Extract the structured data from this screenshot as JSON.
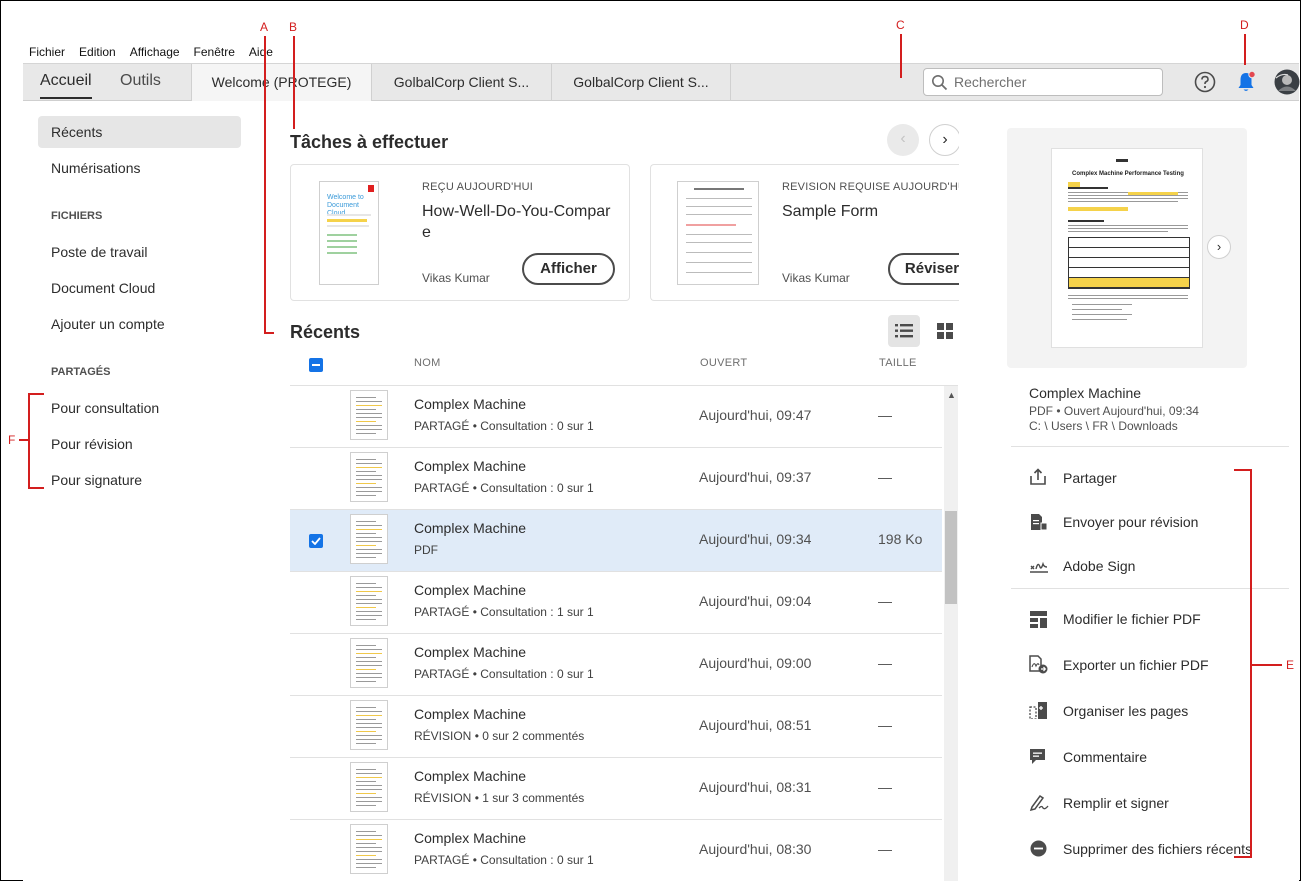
{
  "menu": {
    "items": [
      "Fichier",
      "Edition",
      "Affichage",
      "Fenêtre",
      "Aide"
    ]
  },
  "tabbar": {
    "home_tab": "Accueil",
    "tools_tab": "Outils",
    "doc_tabs": [
      "Welcome (PROTEGE)",
      "GolbalCorp Client S...",
      "GolbalCorp Client S..."
    ],
    "search_placeholder": "Rechercher"
  },
  "sidebar": {
    "recent": "Récents",
    "scans": "Numérisations",
    "files_heading": "FICHIERS",
    "files": [
      "Poste de travail",
      "Document Cloud",
      "Ajouter un compte"
    ],
    "shared_heading": "PARTAGÉS",
    "shared": [
      "Pour consultation",
      "Pour révision",
      "Pour signature"
    ]
  },
  "tasks": {
    "heading": "Tâches à effectuer",
    "cards": [
      {
        "tag": "REÇU AUJOURD'HUI",
        "title": "How-Well-Do-You-Compare",
        "owner": "Vikas Kumar",
        "button": "Afficher",
        "thumb_text": "Welcome to Document Cloud"
      },
      {
        "tag": "REVISION REQUISE AUJOURD'HUI",
        "title": "Sample Form",
        "owner": "Vikas Kumar",
        "button": "Réviser"
      }
    ]
  },
  "recent": {
    "heading": "Récents",
    "columns": {
      "name": "NOM",
      "opened": "OUVERT",
      "size": "TAILLE"
    },
    "rows": [
      {
        "name": "Complex Machine",
        "tag": "PARTAGÉ",
        "detail": "Consultation : 0 sur 1",
        "opened": "Aujourd'hui, 09:47",
        "size": "—",
        "selected": false
      },
      {
        "name": "Complex Machine",
        "tag": "PARTAGÉ",
        "detail": "Consultation : 0 sur 1",
        "opened": "Aujourd'hui, 09:37",
        "size": "—",
        "selected": false
      },
      {
        "name": "Complex Machine",
        "tag": "PDF",
        "detail": "",
        "opened": "Aujourd'hui, 09:34",
        "size": "198 Ko",
        "selected": true
      },
      {
        "name": "Complex Machine",
        "tag": "PARTAGÉ",
        "detail": "Consultation : 1 sur 1",
        "opened": "Aujourd'hui, 09:04",
        "size": "—",
        "selected": false
      },
      {
        "name": "Complex Machine",
        "tag": "PARTAGÉ",
        "detail": "Consultation : 0 sur 1",
        "opened": "Aujourd'hui, 09:00",
        "size": "—",
        "selected": false
      },
      {
        "name": "Complex Machine",
        "tag": "RÉVISION",
        "detail": "0 sur 2 commentés",
        "opened": "Aujourd'hui, 08:51",
        "size": "—",
        "selected": false
      },
      {
        "name": "Complex Machine",
        "tag": "RÉVISION",
        "detail": "1 sur 3 commentés",
        "opened": "Aujourd'hui, 08:31",
        "size": "—",
        "selected": false
      },
      {
        "name": "Complex Machine",
        "tag": "PARTAGÉ",
        "detail": "Consultation : 0 sur 1",
        "opened": "Aujourd'hui, 08:30",
        "size": "—",
        "selected": false
      }
    ]
  },
  "details": {
    "name": "Complex Machine",
    "type": "PDF",
    "opened": "Ouvert Aujourd'hui, 09:34",
    "path": "C: \\ Users \\ FR \\ Downloads",
    "preview_title": "Complex Machine Performance Testing",
    "actions_top": [
      "Partager",
      "Envoyer pour révision",
      "Adobe Sign"
    ],
    "actions_bottom": [
      "Modifier le fichier PDF",
      "Exporter un fichier PDF",
      "Organiser les pages",
      "Commentaire",
      "Remplir et signer",
      "Supprimer des fichiers récents"
    ]
  },
  "annotations": [
    "A",
    "B",
    "C",
    "D",
    "E",
    "F"
  ],
  "colors": {
    "accent": "#1473e6",
    "annotation": "#d31e1e",
    "selected_row": "#e0ebf8",
    "notification_dot": "#e34850"
  }
}
